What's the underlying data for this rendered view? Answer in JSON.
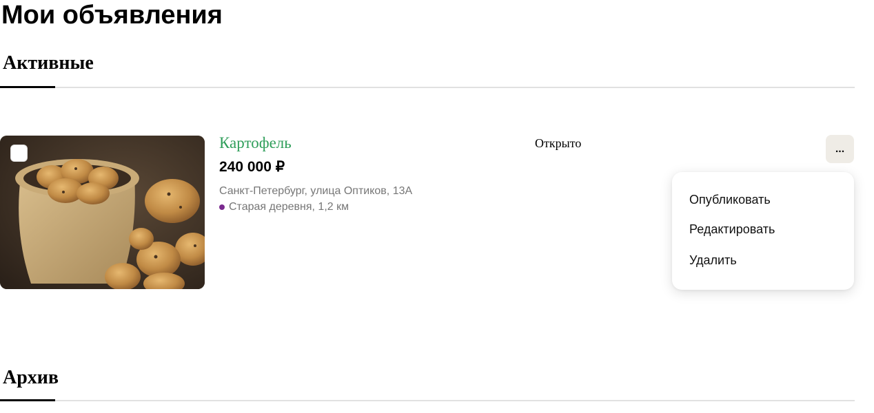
{
  "page": {
    "title": "Мои объявления"
  },
  "sections": {
    "active": {
      "title": "Активные"
    },
    "archive": {
      "title": "Архив"
    }
  },
  "listing": {
    "title": "Картофель",
    "price": "240 000 ₽",
    "address": "Санкт-Петербург, улица Оптиков, 13А",
    "metro": "Старая деревня, 1,2 км",
    "status": "Открыто",
    "more_label": "...",
    "photo_icon": "potatoes-photo"
  },
  "menu": {
    "items": [
      {
        "label": "Опубликовать"
      },
      {
        "label": "Редактировать"
      },
      {
        "label": "Удалить"
      }
    ]
  },
  "colors": {
    "title_link": "#2f9e5a",
    "metro_line": "#7a2a8f",
    "more_button_bg": "#efece6",
    "secondary_text": "#767676"
  }
}
